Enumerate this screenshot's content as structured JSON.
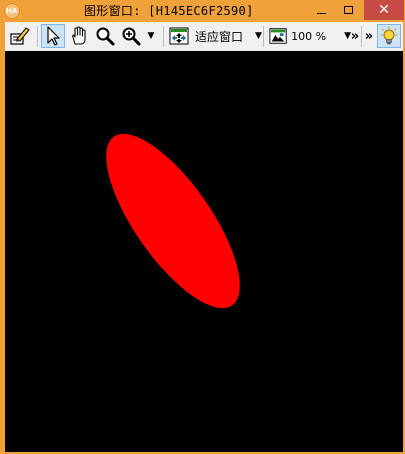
{
  "window": {
    "title": "图形窗口: [H145EC6F2590]",
    "app_icon_text": "HA"
  },
  "toolbar": {
    "fit_label": "适应窗口",
    "zoom_label": "100 %",
    "overflow_label": "»"
  },
  "canvas": {
    "background_color": "#000000",
    "shape": {
      "type": "ellipse",
      "fill_color": "#ff0000"
    }
  },
  "colors": {
    "title_bar": "#f0a13a",
    "close_button": "#c74b45",
    "toolbar_bg": "#f0f0f0",
    "selected_tool": "#cce4f7"
  }
}
